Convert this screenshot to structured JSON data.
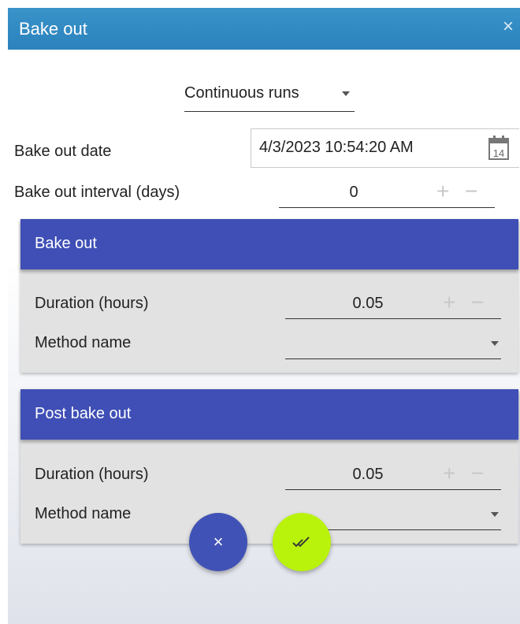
{
  "window": {
    "title": "Bake out",
    "close_glyph": "×"
  },
  "mode": {
    "selected": "Continuous runs"
  },
  "bakeout_date": {
    "label": "Bake out date",
    "value": "4/3/2023 10:54:20 AM",
    "calendar_day": "14"
  },
  "bakeout_interval": {
    "label": "Bake out interval (days)",
    "value": "0"
  },
  "bake_out_panel": {
    "header": "Bake out",
    "duration_label": "Duration (hours)",
    "duration_value": "0.05",
    "method_label": "Method name",
    "method_value": ""
  },
  "post_bake_out_panel": {
    "header": "Post bake out",
    "duration_label": "Duration (hours)",
    "duration_value": "0.05",
    "method_label": "Method name",
    "method_value": ""
  },
  "buttons": {
    "cancel_glyph": "×"
  },
  "colors": {
    "titlebar": "#2b86c3",
    "panel_header": "#3f4fb5",
    "cancel": "#4152b6",
    "ok": "#b9f30b"
  },
  "icons": {
    "plus": "+",
    "minus": "−"
  }
}
